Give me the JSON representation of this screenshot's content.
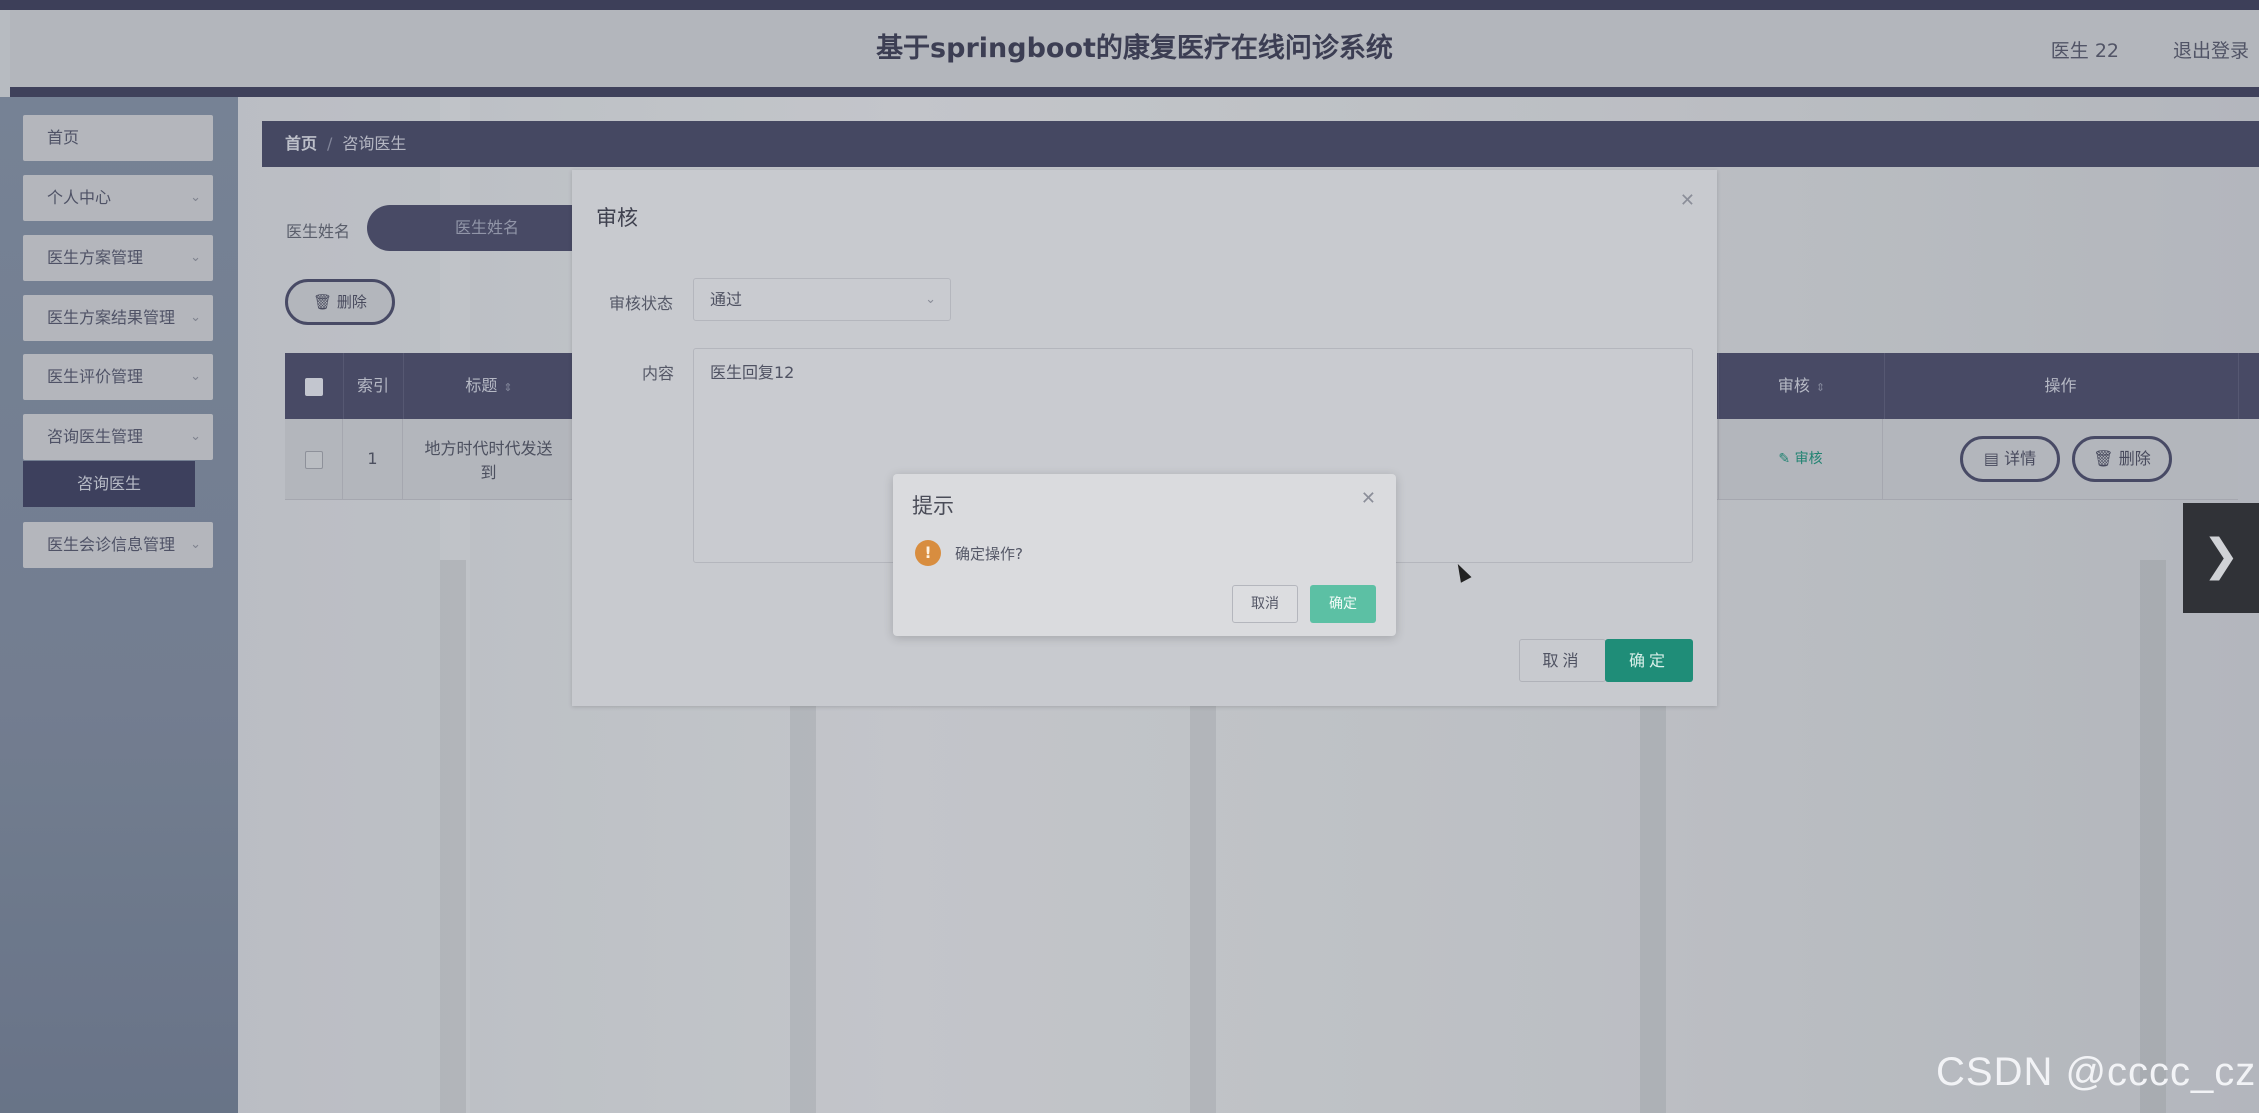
{
  "header": {
    "title": "基于springboot的康复医疗在线问诊系统",
    "user": "医生 22",
    "logout": "退出登录"
  },
  "sidebar": {
    "items": [
      {
        "label": "首页"
      },
      {
        "label": "个人中心"
      },
      {
        "label": "医生方案管理"
      },
      {
        "label": "医生方案结果管理"
      },
      {
        "label": "医生评价管理"
      },
      {
        "label": "咨询医生管理"
      },
      {
        "label": "咨询医生"
      },
      {
        "label": "医生会诊信息管理"
      }
    ]
  },
  "breadcrumb": {
    "home": "首页",
    "separator": "/",
    "current": "咨询医生"
  },
  "search": {
    "label": "医生姓名",
    "placeholder": "医生姓名"
  },
  "toolbar": {
    "delete_label": "删除"
  },
  "table": {
    "columns": [
      "索引",
      "标题",
      "审核",
      "操作"
    ],
    "rows": [
      {
        "index": "1",
        "title": "地方时代时代发送到",
        "review": "审核",
        "detail": "详情",
        "delete": "删除"
      }
    ]
  },
  "review_dialog": {
    "title": "审核",
    "status_label": "审核状态",
    "status_value": "通过",
    "content_label": "内容",
    "content_value": "医生回复12",
    "cancel": "取消",
    "ok": "确定"
  },
  "confirm_box": {
    "title": "提示",
    "message": "确定操作?",
    "cancel": "取消",
    "ok": "确定"
  },
  "watermark": "CSDN @cccc_cz",
  "colors": {
    "header_dark": "#40415e",
    "accent_green": "#1f8d78",
    "confirm_green": "#5cc0a4",
    "warning": "#d88d3f"
  }
}
